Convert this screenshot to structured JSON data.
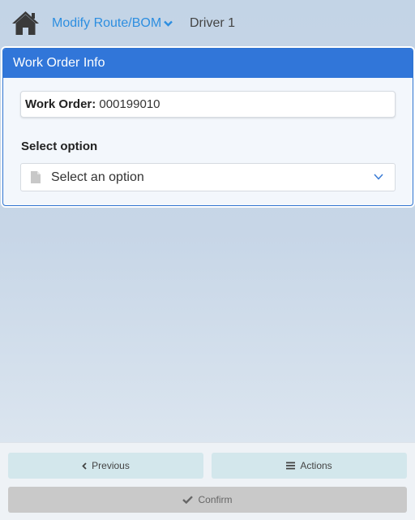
{
  "header": {
    "home_icon": "home-icon",
    "menu_label": "Modify Route/BOM",
    "menu_icon": "chevron-down-icon",
    "driver": "Driver 1",
    "link_color": "#2d8ee0"
  },
  "panel": {
    "title": "Work Order Info",
    "header_color": "#3176d9",
    "work_order_label": "Work Order:",
    "work_order_value": "000199010",
    "select_label": "Select option",
    "select_placeholder": "Select an option",
    "select_icon": "document-icon"
  },
  "footer": {
    "previous_label": "Previous",
    "actions_label": "Actions",
    "confirm_label": "Confirm",
    "previous_icon": "chevron-left-icon",
    "actions_icon": "hamburger-icon",
    "confirm_icon": "checkmark-icon"
  }
}
